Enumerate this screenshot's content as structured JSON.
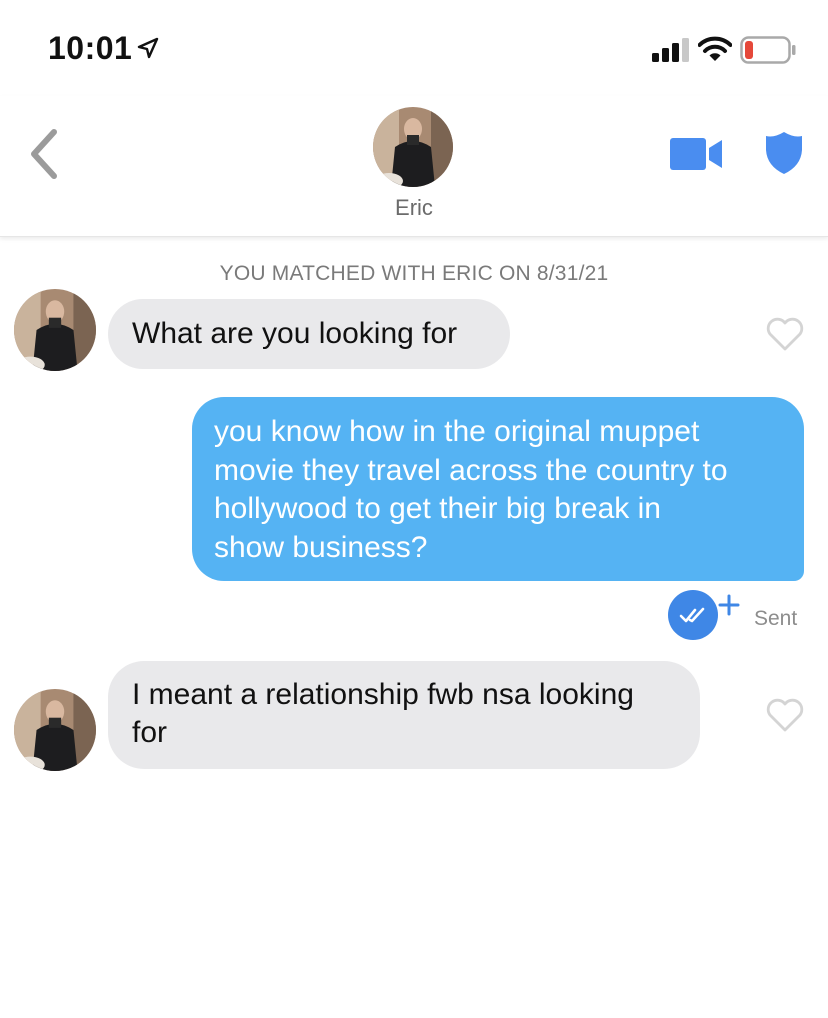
{
  "status_bar": {
    "time": "10:01",
    "icons": [
      "location-arrow-icon",
      "signal-icon",
      "wifi-icon",
      "battery-low-icon"
    ]
  },
  "header": {
    "back_icon": "chevron-left-icon",
    "name": "Eric",
    "actions": [
      "video-call-icon",
      "safety-shield-icon"
    ],
    "accent_color": "#4a8df0"
  },
  "conversation": {
    "match_notice": "YOU MATCHED WITH ERIC ON 8/31/21",
    "messages": [
      {
        "from": "Eric",
        "direction": "incoming",
        "text": "What are you looking for"
      },
      {
        "from": "me",
        "direction": "outgoing",
        "lines": [
          "you know how in the original muppet",
          "movie they travel across the country to",
          "hollywood to get their big break in",
          "show business?"
        ]
      },
      {
        "from": "Eric",
        "direction": "incoming",
        "lines": [
          "I meant a relationship fwb nsa looking",
          "for"
        ]
      }
    ],
    "receipt": {
      "status": "Sent",
      "icon": "double-check-icon"
    }
  },
  "colors": {
    "outgoing_bubble": "#55b3f3",
    "incoming_bubble": "#e9e9eb",
    "read_badge": "#3f87e6",
    "battery_low": "#e5483a"
  }
}
